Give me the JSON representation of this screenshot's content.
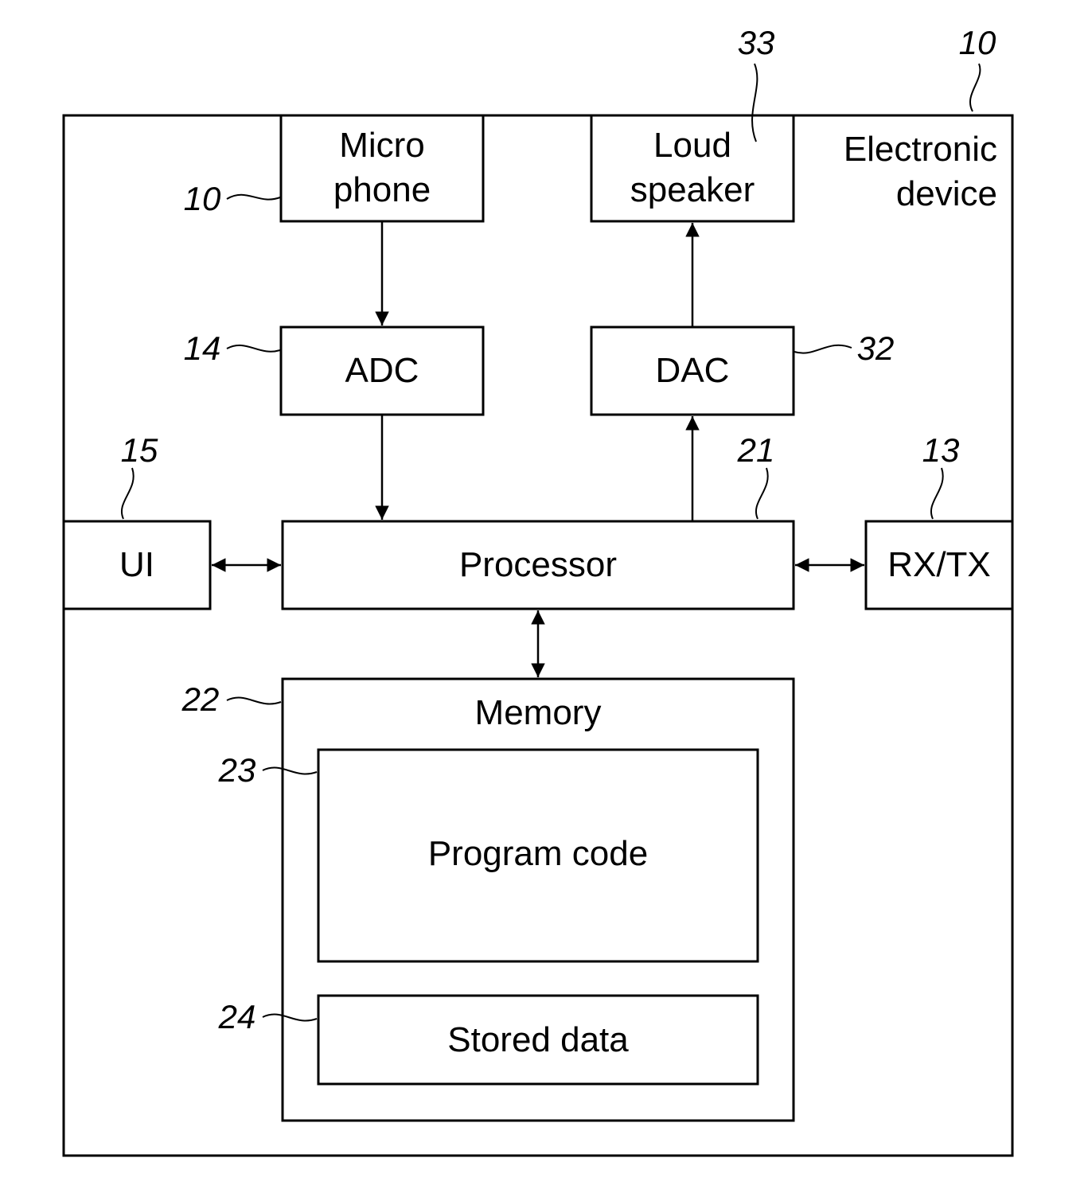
{
  "diagram": {
    "device": {
      "label_line1": "Electronic",
      "label_line2": "device",
      "ref": "10"
    },
    "microphone": {
      "label_line1": "Micro",
      "label_line2": "phone",
      "ref": "10"
    },
    "loudspeaker": {
      "label_line1": "Loud",
      "label_line2": "speaker",
      "ref": "33"
    },
    "adc": {
      "label": "ADC",
      "ref": "14"
    },
    "dac": {
      "label": "DAC",
      "ref": "32"
    },
    "ui": {
      "label": "UI",
      "ref": "15"
    },
    "processor": {
      "label": "Processor",
      "ref": "21"
    },
    "rxtx": {
      "label": "RX/TX",
      "ref": "13"
    },
    "memory": {
      "label": "Memory",
      "ref": "22"
    },
    "program_code": {
      "label": "Program code",
      "ref": "23"
    },
    "stored_data": {
      "label": "Stored data",
      "ref": "24"
    },
    "connections": [
      {
        "from": "microphone",
        "to": "adc",
        "direction": "one-way"
      },
      {
        "from": "adc",
        "to": "processor",
        "direction": "one-way"
      },
      {
        "from": "processor",
        "to": "dac",
        "direction": "one-way"
      },
      {
        "from": "dac",
        "to": "loudspeaker",
        "direction": "one-way"
      },
      {
        "from": "ui",
        "to": "processor",
        "direction": "two-way"
      },
      {
        "from": "processor",
        "to": "rxtx",
        "direction": "two-way"
      },
      {
        "from": "processor",
        "to": "memory",
        "direction": "two-way"
      }
    ]
  }
}
